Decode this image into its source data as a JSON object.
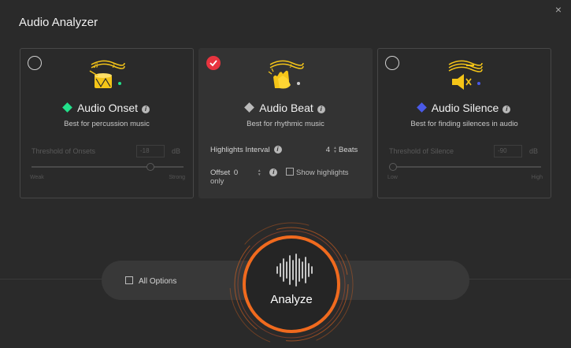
{
  "window": {
    "title": "Audio Analyzer",
    "close_glyph": "×"
  },
  "cards": [
    {
      "name": "Audio Onset",
      "description": "Best for percussion music",
      "diamond_color": "#22e08a",
      "selected": false,
      "icon": "drum-icon",
      "threshold_label": "Threshold of Onsets",
      "threshold_value": "-18",
      "threshold_unit": "dB",
      "slider_min_label": "Weak",
      "slider_max_label": "Strong",
      "slider_value_fraction": 0.9
    },
    {
      "name": "Audio Beat",
      "description": "Best for rhythmic music",
      "diamond_color": "#bbbbbb",
      "selected": true,
      "icon": "clapping-hands-icon",
      "highlights_label": "Highlights Interval",
      "highlights_value": "4",
      "highlights_unit": "Beats",
      "offset_label": "Offset",
      "offset_value": "0",
      "show_highlights_label": "Show highlights only"
    },
    {
      "name": "Audio Silence",
      "description": "Best for finding silences in audio",
      "diamond_color": "#4a5ae8",
      "selected": false,
      "icon": "speaker-mute-icon",
      "threshold_label": "Threshold of Silence",
      "threshold_value": "-90",
      "threshold_unit": "dB",
      "slider_min_label": "Low",
      "slider_max_label": "High",
      "slider_value_fraction": 0.0
    }
  ],
  "footer": {
    "all_options_label": "All Options",
    "analyze_label": "Analyze"
  },
  "colors": {
    "accent": "#f06a1e",
    "selected_check": "#e8343f",
    "icon_yellow": "#f5c518"
  }
}
